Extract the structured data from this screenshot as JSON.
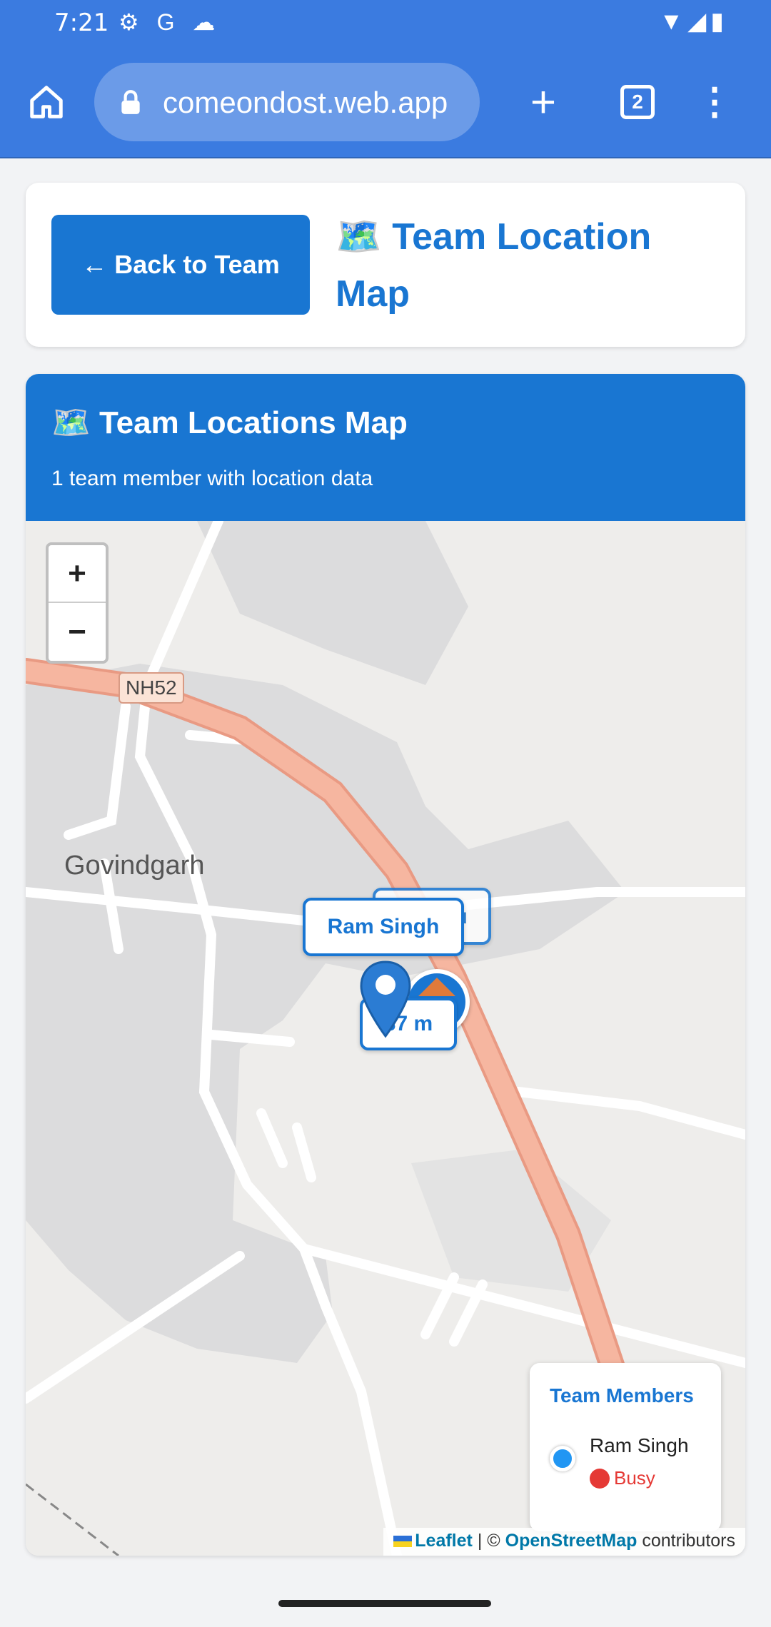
{
  "status_bar": {
    "time": "7:21",
    "left_icons": "⚙ G ☁",
    "right_icons": "▼◢▮"
  },
  "browser": {
    "url": "comeondost.web.app",
    "tab_count": "2",
    "plus": "+",
    "menu": "⋮"
  },
  "header": {
    "back_label": "← Back to Team",
    "title": "🗺️ Team Location Map"
  },
  "map_card": {
    "title": "🗺️ Team Locations Map",
    "subtitle": "1 team member with location data"
  },
  "map": {
    "zoom_in": "+",
    "zoom_out": "−",
    "town": "Govindgarh",
    "road_shield": "NH52",
    "you_label": "📍 You",
    "member_label": "Ram Singh",
    "distance_label": "37 m"
  },
  "legend": {
    "title": "Team Members",
    "members": [
      {
        "name": "Ram Singh",
        "status": "Busy",
        "dot_color": "#2196f3",
        "status_color": "#e53935"
      }
    ]
  },
  "attribution": {
    "leaflet": "Leaflet",
    "separator": "| ©",
    "osm": "OpenStreetMap",
    "suffix": "contributors"
  },
  "colors": {
    "accent": "#1976d2",
    "browser_bar": "#3b7be0"
  }
}
